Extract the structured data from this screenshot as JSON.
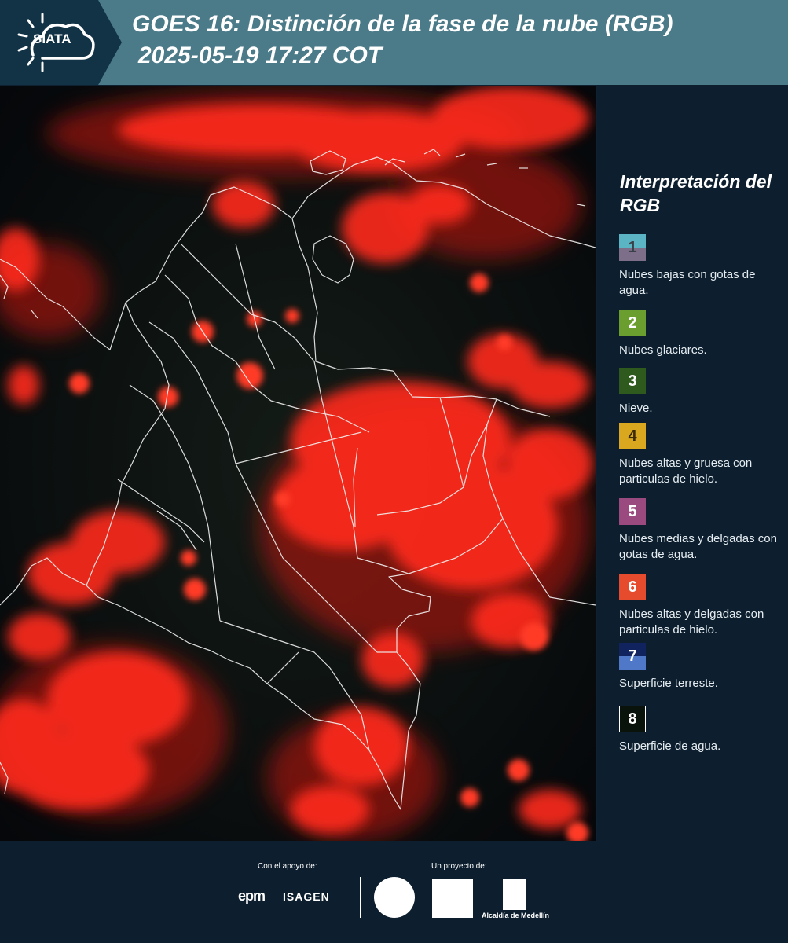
{
  "header": {
    "logo_text": "SIATA",
    "title_line1": "GOES 16: Distinción de la fase de la nube (RGB)",
    "title_line2": "2025-05-19 17:27 COT"
  },
  "legend": {
    "title": "Interpretación del RGB",
    "items": [
      {
        "num": "1",
        "desc": "Nubes bajas con gotas de agua.",
        "color_top": "#5ab4c4",
        "color_bottom": "#7d6e8a",
        "num_color": "#3b3f48"
      },
      {
        "num": "2",
        "desc": "Nubes glaciares.",
        "color_top": "#6a9e2e",
        "color_bottom": "#6a9e2e",
        "num_color": "#ffffff"
      },
      {
        "num": "3",
        "desc": "Nieve.",
        "color_top": "#2f5a1e",
        "color_bottom": "#2f5a1e",
        "num_color": "#ffffff"
      },
      {
        "num": "4",
        "desc": "Nubes altas y gruesa con particulas de hielo.",
        "color_top": "#d9a81f",
        "color_bottom": "#d9a81f",
        "num_color": "#3a2a05"
      },
      {
        "num": "5",
        "desc": "Nubes medias y delgadas con gotas de agua.",
        "color_top": "#9a4a7e",
        "color_bottom": "#9a4a7e",
        "num_color": "#ffffff"
      },
      {
        "num": "6",
        "desc": "Nubes altas y delgadas con particulas de hielo.",
        "color_top": "#e54b2c",
        "color_bottom": "#e54b2c",
        "num_color": "#ffffff"
      },
      {
        "num": "7",
        "desc": "Superficie terreste.",
        "color_top": "#10235e",
        "color_bottom": "#4f78c8",
        "num_color": "#ffffff"
      },
      {
        "num": "8",
        "desc": "Superficie de agua.",
        "color_top": "#0a120c",
        "color_bottom": "#0a120c",
        "num_color": "#ffffff"
      }
    ]
  },
  "footer": {
    "support_label": "Con el apoyo de:",
    "project_label": "Un proyecto de:",
    "epm": "epm",
    "isagen": "ISAGEN",
    "alcaldia": "Alcaldía de Medellín"
  },
  "colors": {
    "header_bg": "#4b7a89",
    "logo_band": "#123246",
    "panel_bg": "#0d1f2e",
    "cloud_red": "#ff2a1a"
  }
}
